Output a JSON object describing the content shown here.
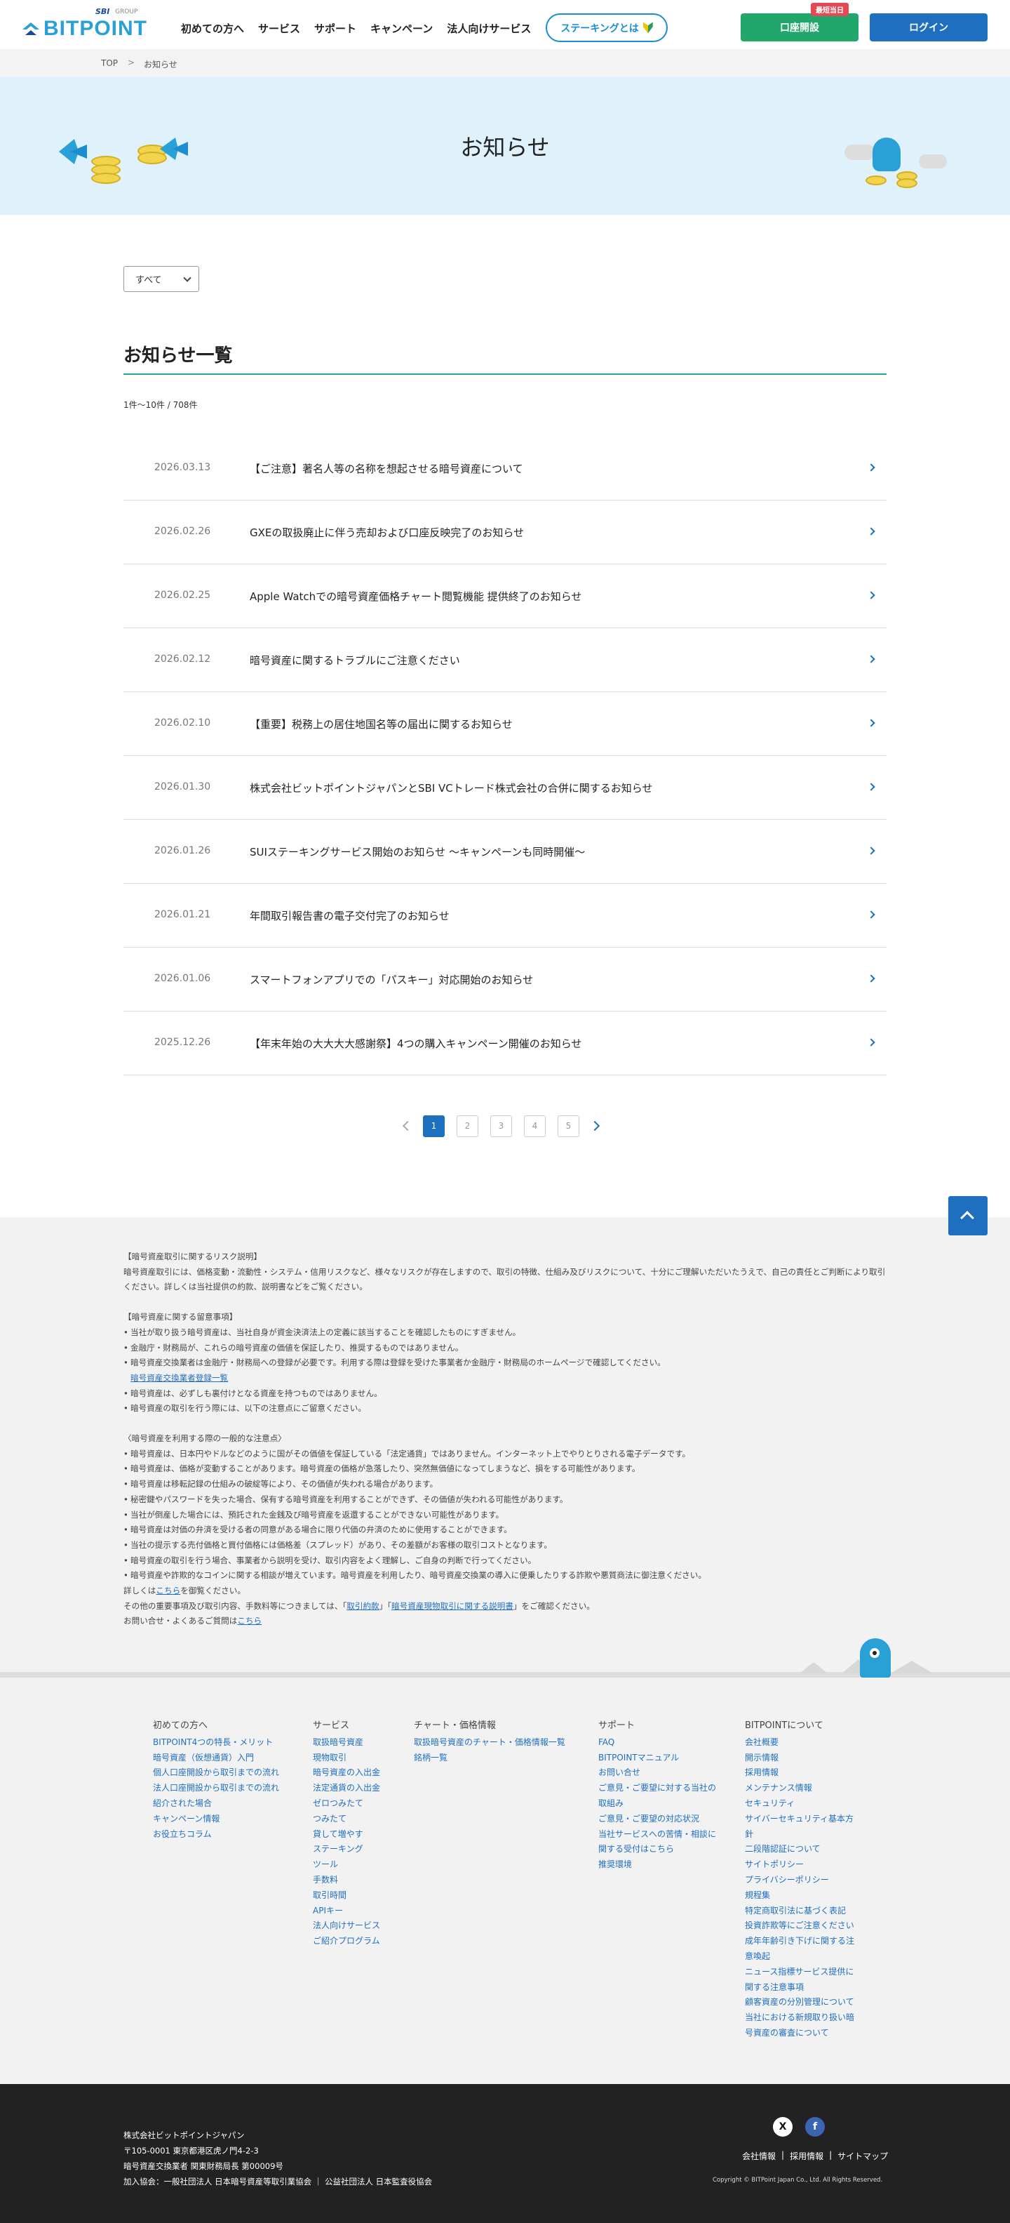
{
  "header": {
    "logo": {
      "sbi": "SBI",
      "group": "GROUP",
      "brand": "BITPOINT"
    },
    "nav": [
      "初めての方へ",
      "サービス",
      "サポート",
      "キャンペーン",
      "法人向けサービス"
    ],
    "staking_button": "ステーキングとは",
    "open_account_badge": "最短当日",
    "open_account_button": "口座開設",
    "login_button": "ログイン",
    "colors": {
      "brand": "#29a0d6",
      "open_account": "#21a66b",
      "login": "#1e6fc0",
      "accent_line": "#1ea59a"
    }
  },
  "breadcrumb": {
    "home": "TOP",
    "separator": ">",
    "current": "お知らせ"
  },
  "hero": {
    "title": "お知らせ"
  },
  "filter": {
    "selected": "すべて"
  },
  "list": {
    "title": "お知らせ一覧",
    "count": "1件～10件 / 708件",
    "items": [
      {
        "date": "2026.03.13",
        "title": "【ご注意】著名人等の名称を想起させる暗号資産について"
      },
      {
        "date": "2026.02.26",
        "title": "GXEの取扱廃止に伴う売却および口座反映完了のお知らせ"
      },
      {
        "date": "2026.02.25",
        "title": "Apple Watchでの暗号資産価格チャート閲覧機能 提供終了のお知らせ"
      },
      {
        "date": "2026.02.12",
        "title": "暗号資産に関するトラブルにご注意ください"
      },
      {
        "date": "2026.02.10",
        "title": "【重要】税務上の居住地国名等の届出に関するお知らせ"
      },
      {
        "date": "2026.01.30",
        "title": "株式会社ビットポイントジャパンとSBI VCトレード株式会社の合併に関するお知らせ"
      },
      {
        "date": "2026.01.26",
        "title": "SUIステーキングサービス開始のお知らせ 〜キャンペーンも同時開催〜"
      },
      {
        "date": "2026.01.21",
        "title": "年間取引報告書の電子交付完了のお知らせ"
      },
      {
        "date": "2026.01.06",
        "title": "スマートフォンアプリでの「パスキー」対応開始のお知らせ"
      },
      {
        "date": "2025.12.26",
        "title": "【年末年始の大大大大感謝祭】4つの購入キャンペーン開催のお知らせ"
      }
    ]
  },
  "pagination": {
    "pages": [
      "1",
      "2",
      "3",
      "4",
      "5"
    ],
    "current": "1"
  },
  "risk": {
    "s1_title": "【暗号資産取引に関するリスク説明】",
    "s1_body": "暗号資産取引には、価格変動・流動性・システム・信用リスクなど、様々なリスクが存在しますので、取引の特徴、仕組み及びリスクについて、十分にご理解いただいたうえで、自己の責任とご判断により取引ください。詳しくは当社提供の約款、説明書などをご覧ください。",
    "s2_title": "【暗号資産に関する留意事項】",
    "s2_items": [
      "当社が取り扱う暗号資産は、当社自身が資金決済法上の定義に該当することを確認したものにすぎません。",
      "金融庁・財務局が、これらの暗号資産の価値を保証したり、推奨するものではありません。",
      "暗号資産交換業者は金融庁・財務局への登録が必要です。利用する際は登録を受けた事業者か金融庁・財務局のホームページで確認してください。"
    ],
    "s2_link": "暗号資産交換業者登録一覧",
    "s2_items2": [
      "暗号資産は、必ずしも裏付けとなる資産を持つものではありません。",
      "暗号資産の取引を行う際には、以下の注意点にご留意ください。"
    ],
    "s3_title": "〈暗号資産を利用する際の一般的な注意点〉",
    "s3_items": [
      "暗号資産は、日本円やドルなどのように国がその価値を保証している「法定通貨」ではありません。インターネット上でやりとりされる電子データです。",
      "暗号資産は、価格が変動することがあります。暗号資産の価格が急落したり、突然無価値になってしまうなど、損をする可能性があります。",
      "暗号資産は移転記録の仕組みの破綻等により、その価値が失われる場合があります。",
      "秘密鍵やパスワードを失った場合、保有する暗号資産を利用することができず、その価値が失われる可能性があります。",
      "当社が倒産した場合には、預託された金銭及び暗号資産を返還することができない可能性があります。",
      "暗号資産は対価の弁済を受ける者の同意がある場合に限り代価の弁済のために使用することができます。",
      "当社の提示する売付価格と買付価格には価格差（スプレッド）があり、その差額がお客様の取引コストとなります。",
      "暗号資産の取引を行う場合、事業者から説明を受け、取引内容をよく理解し、ご自身の判断で行ってください。",
      "暗号資産や詐欺的なコインに関する相談が増えています。暗号資産を利用したり、暗号資産交換業の導入に便乗したりする詐欺や悪質商法に御注意ください。"
    ],
    "detail_prefix": "詳しくは",
    "detail_link": "こちら",
    "detail_suffix": "を御覧ください。",
    "fees_prefix": "その他の重要事項及び取引内容、手数料等につきましては、「",
    "fees_link1": "取引約款",
    "fees_mid": "」「",
    "fees_link2": "暗号資産現物取引に関する説明書",
    "fees_suffix": "」をご確認ください。",
    "contact_prefix": "お問い合せ・よくあるご質問は",
    "contact_link": "こちら"
  },
  "footer": {
    "col1": {
      "title": "初めての方へ",
      "items": [
        "BITPOINT4つの特長・メリット",
        "暗号資産（仮想通貨）入門",
        "個人口座開設から取引までの流れ",
        "法人口座開設から取引までの流れ",
        "紹介された場合",
        "キャンペーン情報",
        "お役立ちコラム"
      ]
    },
    "col2": {
      "title": "サービス",
      "items": [
        "取扱暗号資産",
        "現物取引",
        "暗号資産の入出金",
        "法定通貨の入出金",
        "ゼロつみたて",
        "つみたて",
        "貸して増やす",
        "ステーキング",
        "ツール",
        "手数料",
        "取引時間",
        "APIキー",
        "法人向けサービス",
        "ご紹介プログラム"
      ]
    },
    "col3": {
      "title": "チャート・価格情報",
      "items": [
        "取扱暗号資産のチャート・価格情報一覧",
        "銘柄一覧"
      ]
    },
    "col4": {
      "title": "サポート",
      "items": [
        "FAQ",
        "BITPOINTマニュアル",
        "お問い合せ",
        "ご意見・ご要望に対する当社の取組み",
        "ご意見・ご要望の対応状況",
        "当社サービスへの苦情・相談に関する受付はこちら",
        "推奨環境"
      ]
    },
    "col5": {
      "title": "BITPOINTについて",
      "items": [
        "会社概要",
        "開示情報",
        "採用情報",
        "メンテナンス情報",
        "セキュリティ",
        "サイバーセキュリティ基本方針",
        "二段階認証について",
        "サイトポリシー",
        "プライバシーポリシー",
        "規程集",
        "特定商取引法に基づく表記",
        "投資詐欺等にご注意ください",
        "成年年齢引き下げに関する注意喚起",
        "ニュース指標サービス提供に関する注意事項",
        "顧客資産の分別管理について",
        "当社における新規取り扱い暗号資産の審査について"
      ]
    }
  },
  "bottom": {
    "company": "株式会社ビットポイントジャパン",
    "address": "〒105-0001 東京都港区虎ノ門4-2-3",
    "registration": "暗号資産交換業者 関東財務局長 第00009号",
    "association": "加入協会：一般社団法人 日本暗号資産等取引業協会 ｜ 公益社団法人 日本監査役協会",
    "sns": [
      "X",
      "f"
    ],
    "links": [
      "会社情報",
      "採用情報",
      "サイトマップ"
    ],
    "link_separator": "|",
    "copyright": "Copyright © BITPoint Japan Co., Ltd. All Rights Reserved."
  }
}
